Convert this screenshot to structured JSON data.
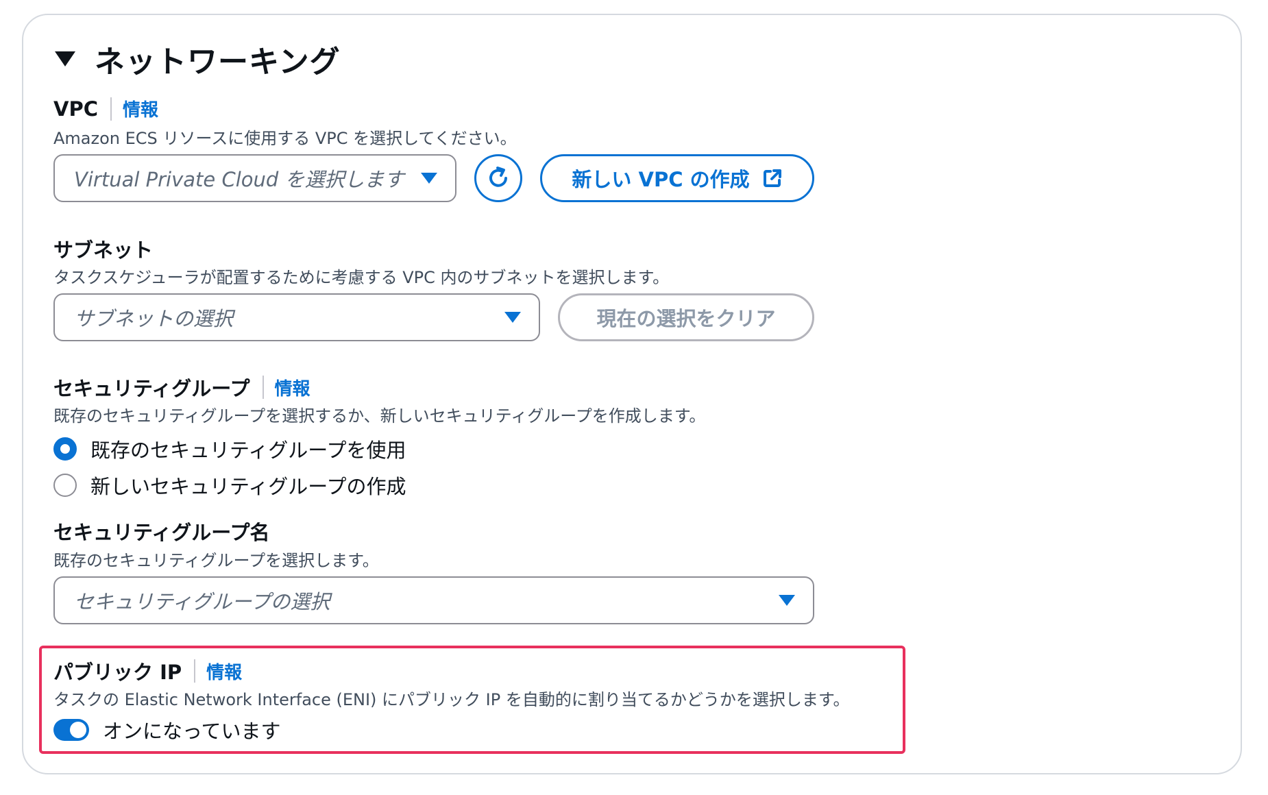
{
  "section": {
    "title": "ネットワーキング"
  },
  "vpc": {
    "label": "VPC",
    "info": "情報",
    "description": "Amazon ECS リソースに使用する VPC を選択してください。",
    "placeholder": "Virtual Private Cloud を選択します",
    "create_button": "新しい VPC の作成"
  },
  "subnet": {
    "label": "サブネット",
    "description": "タスクスケジューラが配置するために考慮する VPC 内のサブネットを選択します。",
    "placeholder": "サブネットの選択",
    "clear_button": "現在の選択をクリア"
  },
  "security_group": {
    "label": "セキュリティグループ",
    "info": "情報",
    "description": "既存のセキュリティグループを選択するか、新しいセキュリティグループを作成します。",
    "options": [
      "既存のセキュリティグループを使用",
      "新しいセキュリティグループの作成"
    ],
    "selected": "既存のセキュリティグループを使用"
  },
  "security_group_name": {
    "label": "セキュリティグループ名",
    "description": "既存のセキュリティグループを選択します。",
    "placeholder": "セキュリティグループの選択"
  },
  "public_ip": {
    "label": "パブリック IP",
    "info": "情報",
    "description": "タスクの Elastic Network Interface (ENI) にパブリック IP を自動的に割り当てるかどうかを選択します。",
    "toggle_label": "オンになっています",
    "toggle_on": true
  },
  "colors": {
    "accent": "#0972d3",
    "highlight": "#e8305d",
    "text": "#0f141a",
    "muted": "#414d5c"
  },
  "icons": [
    "caret-down-icon",
    "refresh-icon",
    "external-link-icon",
    "dropdown-triangle-icon"
  ]
}
